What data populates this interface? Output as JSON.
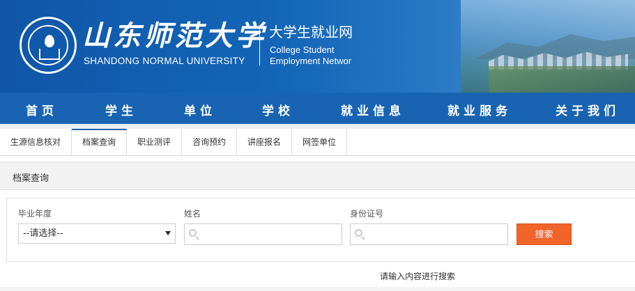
{
  "header": {
    "school_name": "山东师范大学",
    "school_name_en": "SHANDONG NORMAL UNIVERSITY",
    "site_name": "大学生就业网",
    "site_name_en_line1": "College Student",
    "site_name_en_line2": "Employment Networ"
  },
  "main_nav": {
    "items": [
      "首页",
      "学生",
      "单位",
      "学校",
      "就业信息",
      "就业服务",
      "关于我们"
    ]
  },
  "sub_tabs": {
    "items": [
      "生源信息核对",
      "档案查询",
      "职业测评",
      "咨询预约",
      "讲座报名",
      "网签单位"
    ],
    "active": "档案查询"
  },
  "section": {
    "title": "档案查询"
  },
  "search_form": {
    "year_label": "毕业年度",
    "year_value": "--请选择--",
    "name_label": "姓名",
    "name_value": "",
    "id_label": "身份证号",
    "id_value": "",
    "search_button": "搜索",
    "hint": "请输入内容进行搜索"
  },
  "colors": {
    "brand_blue": "#1964b2",
    "search_orange": "#f0642a"
  }
}
